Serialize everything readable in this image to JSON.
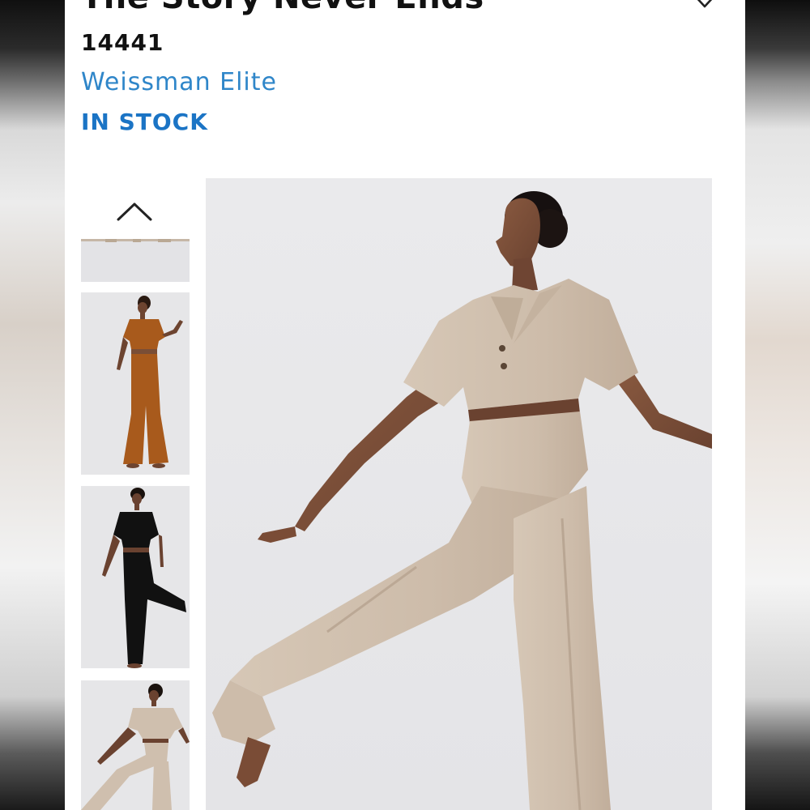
{
  "product": {
    "title": "The Story Never Ends",
    "sku": "14441",
    "brand": "Weissman Elite",
    "stock_status": "IN STOCK"
  },
  "icons": {
    "wishlist": "heart-outline-icon",
    "thumbnail_up": "chevron-up-icon"
  },
  "colors": {
    "brand_link": "#2f86c9",
    "stock": "#1b74c5",
    "outfit_tan": "#cfbfae",
    "outfit_rust": "#a85a1c",
    "outfit_black": "#111111"
  },
  "gallery": {
    "thumbnails": [
      {
        "name": "partial",
        "color": "#cfbfae"
      },
      {
        "name": "rust",
        "color": "#a85a1c"
      },
      {
        "name": "black",
        "color": "#111111"
      },
      {
        "name": "tan",
        "color": "#cfbfae"
      }
    ]
  }
}
